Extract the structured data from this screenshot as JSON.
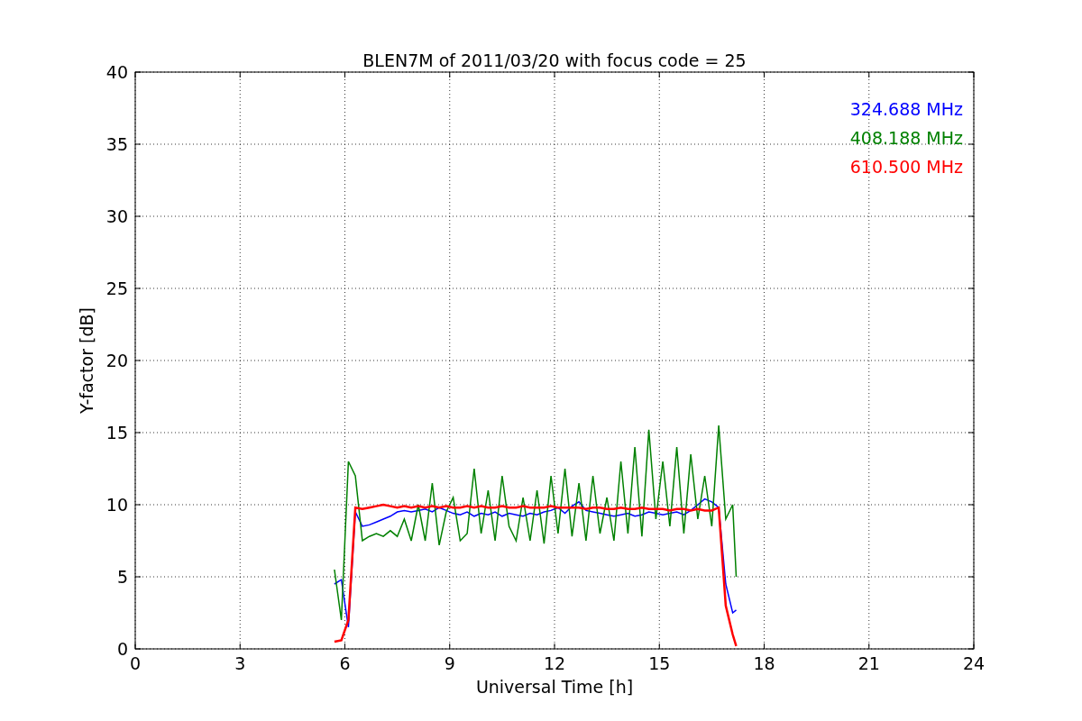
{
  "chart_data": {
    "type": "line",
    "title": "BLEN7M of 2011/03/20 with focus code = 25",
    "xlabel": "Universal Time [h]",
    "ylabel": "Y-factor [dB]",
    "grid": true,
    "xlim": [
      0,
      24
    ],
    "ylim": [
      0,
      40
    ],
    "xticks": [
      0,
      3,
      6,
      9,
      12,
      15,
      18,
      21,
      24
    ],
    "yticks": [
      0,
      5,
      10,
      15,
      20,
      25,
      30,
      35,
      40
    ],
    "x": [
      5.7,
      5.9,
      6.1,
      6.3,
      6.5,
      6.7,
      6.9,
      7.1,
      7.3,
      7.5,
      7.7,
      7.9,
      8.1,
      8.3,
      8.5,
      8.7,
      8.9,
      9.1,
      9.3,
      9.5,
      9.7,
      9.9,
      10.1,
      10.3,
      10.5,
      10.7,
      10.9,
      11.1,
      11.3,
      11.5,
      11.7,
      11.9,
      12.1,
      12.3,
      12.5,
      12.7,
      12.9,
      13.1,
      13.3,
      13.5,
      13.7,
      13.9,
      14.1,
      14.3,
      14.5,
      14.7,
      14.9,
      15.1,
      15.3,
      15.5,
      15.7,
      15.9,
      16.1,
      16.3,
      16.5,
      16.7,
      16.9,
      17.1,
      17.2
    ],
    "series": [
      {
        "name": "324.688 MHz",
        "color": "#0000ff",
        "values": [
          4.5,
          4.8,
          1.5,
          9.5,
          8.5,
          8.6,
          8.8,
          9.0,
          9.2,
          9.5,
          9.6,
          9.5,
          9.6,
          9.7,
          9.5,
          9.8,
          9.6,
          9.4,
          9.3,
          9.5,
          9.2,
          9.4,
          9.3,
          9.5,
          9.2,
          9.4,
          9.3,
          9.2,
          9.4,
          9.3,
          9.5,
          9.6,
          9.8,
          9.4,
          9.9,
          10.2,
          9.6,
          9.5,
          9.4,
          9.3,
          9.2,
          9.3,
          9.4,
          9.2,
          9.3,
          9.5,
          9.4,
          9.3,
          9.4,
          9.5,
          9.3,
          9.6,
          10.0,
          10.4,
          10.2,
          9.8,
          4.5,
          2.5,
          2.7
        ]
      },
      {
        "name": "408.188 MHz",
        "color": "#008000",
        "values": [
          5.5,
          2,
          13,
          12,
          7.5,
          7.8,
          8,
          7.8,
          8.2,
          7.8,
          9,
          7.5,
          10,
          7.5,
          11.5,
          7.2,
          9.5,
          10.5,
          7.5,
          8,
          12.5,
          8,
          11,
          7.5,
          12,
          8.5,
          7.5,
          10.5,
          7.5,
          11,
          7.3,
          12,
          8,
          12.5,
          7.8,
          11.5,
          7.5,
          12,
          8,
          10.5,
          7.5,
          13,
          8,
          14,
          7.8,
          15.2,
          9,
          13,
          8.5,
          14,
          8,
          13.5,
          9,
          12,
          8.5,
          15.5,
          9,
          10,
          5
        ]
      },
      {
        "name": "610.500 MHz",
        "color": "#ff0000",
        "values": [
          0.5,
          0.6,
          2,
          9.8,
          9.7,
          9.8,
          9.9,
          10,
          9.9,
          9.8,
          9.9,
          9.8,
          9.9,
          9.8,
          9.9,
          9.8,
          9.9,
          9.8,
          9.8,
          9.9,
          9.8,
          9.9,
          9.8,
          9.8,
          9.9,
          9.8,
          9.8,
          9.9,
          9.8,
          9.8,
          9.8,
          9.9,
          9.8,
          9.8,
          9.8,
          9.8,
          9.7,
          9.8,
          9.8,
          9.7,
          9.7,
          9.8,
          9.7,
          9.7,
          9.8,
          9.7,
          9.7,
          9.7,
          9.6,
          9.7,
          9.7,
          9.6,
          9.7,
          9.6,
          9.6,
          9.8,
          3.0,
          1.0,
          0.2
        ]
      }
    ]
  }
}
